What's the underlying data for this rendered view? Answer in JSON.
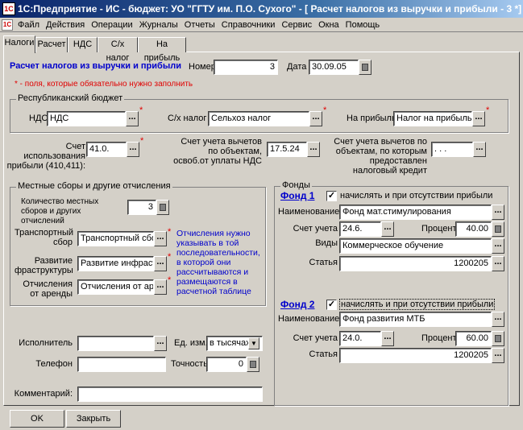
{
  "window": {
    "title": "1С:Предприятие - ИС - бюджет:  УО \"ГГТУ им. П.О. Сухого\" - [ Расчет налогов из выручки и прибыли - 3 *]",
    "app_icon": "1C"
  },
  "menu": [
    "Файл",
    "Действия",
    "Операции",
    "Журналы",
    "Отчеты",
    "Справочники",
    "Сервис",
    "Окна",
    "Помощь"
  ],
  "tabs": [
    "Налоги",
    "Расчет",
    "НДС",
    "С/х налог",
    "На прибыль"
  ],
  "header": {
    "doc_title": "Расчет налогов из выручки и прибыли",
    "number_label": "Номер",
    "number": "3",
    "date_label": "Дата",
    "date": "30.09.05",
    "required_note": "* - поля, которые обязательно нужно заполнить"
  },
  "republic": {
    "title": "Республиканский бюджет",
    "nds_label": "НДС",
    "nds": "НДС",
    "agri_label": "С/х налог",
    "agri": "Сельхоз налог",
    "profit_label": "На прибыль",
    "profit": "Налог на прибыль"
  },
  "accounts": {
    "use_profit_label": "Счет использования прибыли (410,411):",
    "use_profit": "41.0.",
    "exempt_label": "Счет учета вычетов по объектам, освоб.от уплаты НДС",
    "exempt": "17.5.24",
    "benefit_label": "Счет учета вычетов по объектам, по которым предоставлен налоговый кредит",
    "benefit": ". . ."
  },
  "local": {
    "title": "Местные сборы и другие отчисления",
    "count_label": "Количество местных сборов и других отчислений",
    "count": "3",
    "transport_label": "Транспортный сбор",
    "transport": "Транспортный сбор",
    "infra_label": "Развитие фраструктуры",
    "infra": "Развитие инфраструк",
    "rent_label": "Отчисления от аренды",
    "rent": "Отчисления от аренд",
    "note": "Отчисления нужно указывать в той последовательности, в которой они рассчитываются и размещаются в расчетной таблице"
  },
  "funds": {
    "title": "Фонды",
    "fund1": {
      "title": "Фонд 1",
      "check_label": "начислять и при отсутствии прибыли",
      "checked": true,
      "name_label": "Наименование",
      "name": "Фонд мат.стимулирования",
      "account_label": "Счет учета",
      "account": "24.6.",
      "percent_label": "Процент",
      "percent": "40.00",
      "kinds_label": "Виды целевых средств",
      "kinds": "Коммерческое обучение",
      "article_label": "Статья",
      "article": "1200205"
    },
    "fund2": {
      "title": "Фонд 2",
      "check_label": "начислять и при отсутствии прибыли",
      "checked": true,
      "name_label": "Наименование",
      "name": "Фонд развития МТБ",
      "account_label": "Счет учета",
      "account": "24.0.",
      "percent_label": "Процент",
      "percent": "60.00",
      "article_label": "Статья",
      "article": "1200205"
    }
  },
  "bottom": {
    "executor_label": "Исполнитель",
    "executor": "",
    "unit_label": "Ед. изм.",
    "unit": "в тысячах р",
    "phone_label": "Телефон",
    "phone": "",
    "precision_label": "Точность",
    "precision": "0",
    "comment_label": "Комментарий:",
    "comment": ""
  },
  "buttons": {
    "ok": "OK",
    "close": "Закрыть"
  },
  "colors": {
    "title_blue": "#0a246a",
    "link_blue": "#0000cc",
    "required_red": "#e00000",
    "face": "#d4d0c8"
  }
}
